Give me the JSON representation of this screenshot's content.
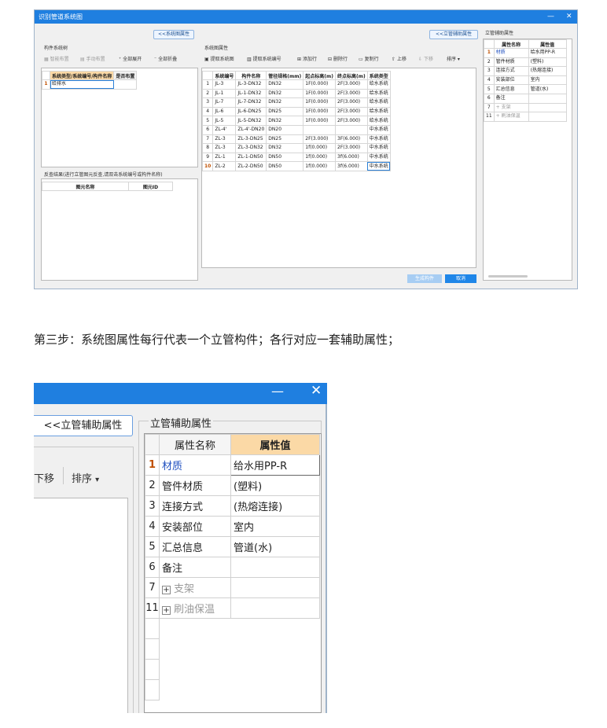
{
  "top_window": {
    "title": "识别管道系统图",
    "minimize_glyph": "—",
    "close_glyph": "✕",
    "back_button": "<<系统图属性",
    "right_button": "<<立管辅助属性",
    "component_group_title": "构件系统树",
    "tree_toolbar": {
      "smart_layout": "智能布置",
      "manual_layout": "手动布置",
      "expand_all": "全部展开",
      "collapse_all": "全部折叠"
    },
    "tree_columns": [
      "系统类型/系统编号/构件名称",
      "是否布置"
    ],
    "tree_rows": [
      {
        "num": "1",
        "name": "给排水",
        "placed": ""
      }
    ],
    "feedback_group_title": "反查结果(进行立管图元反查,请双击系统编号或构件名称)",
    "feedback_columns": [
      "图元名称",
      "图元ID"
    ],
    "sys_group_title": "系统图属性",
    "sys_toolbar": {
      "extract_diagram": "提取系统图",
      "extract_number": "提取系统编号",
      "add_row": "添加行",
      "delete_row": "删除行",
      "copy_row": "复制行",
      "move_up": "上移",
      "move_down": "下移",
      "sort": "排序"
    },
    "sys_columns": [
      "系统编号",
      "构件名称",
      "管径规格(mm)",
      "起点标高(m)",
      "终点标高(m)",
      "系统类型"
    ],
    "sys_rows": [
      [
        "1",
        "JL-3",
        "JL-3-DN32",
        "DN32",
        "1F(0.000)",
        "2F(3.000)",
        "给水系统"
      ],
      [
        "2",
        "JL-1",
        "JL-1-DN32",
        "DN32",
        "1F(0.000)",
        "2F(3.000)",
        "给水系统"
      ],
      [
        "3",
        "JL-7",
        "JL-7-DN32",
        "DN32",
        "1F(0.000)",
        "2F(3.000)",
        "给水系统"
      ],
      [
        "4",
        "JL-6",
        "JL-6-DN25",
        "DN25",
        "1F(0.000)",
        "2F(3.000)",
        "给水系统"
      ],
      [
        "5",
        "JL-5",
        "JL-5-DN32",
        "DN32",
        "1F(0.000)",
        "2F(3.000)",
        "给水系统"
      ],
      [
        "6",
        "ZL-4'",
        "ZL-4'-DN20",
        "DN20",
        "",
        "",
        "中水系统"
      ],
      [
        "7",
        "ZL-3",
        "ZL-3-DN25",
        "DN25",
        "2F(3.000)",
        "3F(6.000)",
        "中水系统"
      ],
      [
        "8",
        "ZL-3",
        "ZL-3-DN32",
        "DN32",
        "1f(0.000)",
        "2F(3.000)",
        "中水系统"
      ],
      [
        "9",
        "ZL-1",
        "ZL-1-DN50",
        "DN50",
        "1f(0.000)",
        "3f(6.000)",
        "中水系统"
      ],
      [
        "10",
        "ZL-2",
        "ZL-2-DN50",
        "DN50",
        "1f(0.000)",
        "3f(6.000)",
        "中水系统"
      ]
    ],
    "generate_button": "生成构件",
    "cancel_button": "取消",
    "riser_group_title": "立管辅助属性",
    "riser_columns": [
      "属性名称",
      "属性值"
    ],
    "riser_rows": [
      {
        "num": "1",
        "name": "材质",
        "value": "给水用PP-R"
      },
      {
        "num": "2",
        "name": "管件材质",
        "value": "(塑料)"
      },
      {
        "num": "3",
        "name": "连接方式",
        "value": "(热熔连接)"
      },
      {
        "num": "4",
        "name": "安装部位",
        "value": "室内"
      },
      {
        "num": "5",
        "name": "汇总信息",
        "value": "管道(水)"
      },
      {
        "num": "6",
        "name": "备注",
        "value": ""
      },
      {
        "num": "7",
        "name": "支架",
        "value": ""
      },
      {
        "num": "11",
        "name": "刷油保温",
        "value": ""
      }
    ]
  },
  "step_text": "第三步：系统图属性每行代表一个立管构件；各行对应一套辅助属性；",
  "zoom_window": {
    "minimize_glyph": "—",
    "close_glyph": "✕",
    "riser_button": "<<立管辅助属性",
    "group_title": "立管辅助属性",
    "move_down": "下移",
    "sort": "排序",
    "sort_arrow": "▾",
    "columns": [
      "属性名称",
      "属性值"
    ],
    "rows": [
      {
        "num": "1",
        "name": "材质",
        "value": "给水用PP-R"
      },
      {
        "num": "2",
        "name": "管件材质",
        "value": "(塑料)"
      },
      {
        "num": "3",
        "name": "连接方式",
        "value": "(热熔连接)"
      },
      {
        "num": "4",
        "name": "安装部位",
        "value": "室内"
      },
      {
        "num": "5",
        "name": "汇总信息",
        "value": "管道(水)"
      },
      {
        "num": "6",
        "name": "备注",
        "value": ""
      },
      {
        "num": "7",
        "name": "支架",
        "value": ""
      },
      {
        "num": "11",
        "name": "刷油保温",
        "value": ""
      }
    ]
  },
  "colors": {
    "title_bar": "#1f7fe0",
    "header_highlight": "#fbd9a6",
    "link_blue": "#2050c0"
  }
}
